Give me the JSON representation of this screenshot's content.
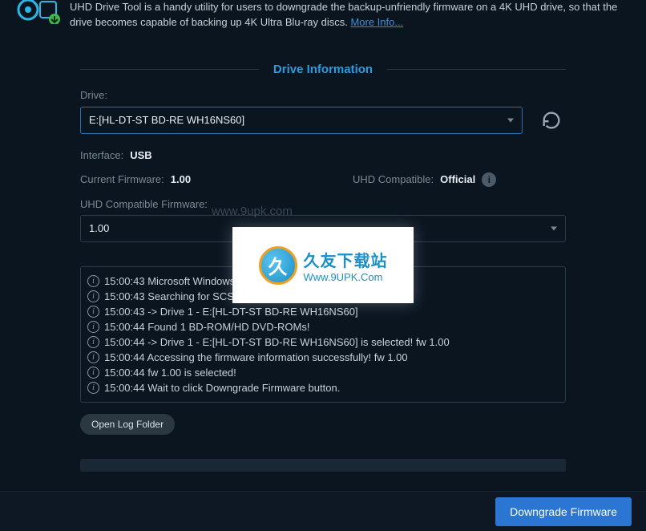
{
  "header": {
    "description": "UHD Drive Tool is a handy utility for users to downgrade the backup-unfriendly firmware on a 4K UHD drive, so that the drive becomes capable of backing up 4K Ultra Blu-ray discs. ",
    "more_info": "More Info..."
  },
  "section_title": "Drive Information",
  "drive": {
    "label": "Drive:",
    "value": "E:[HL-DT-ST BD-RE  WH16NS60]"
  },
  "interface": {
    "label": "Interface:",
    "value": "USB"
  },
  "current_fw": {
    "label": "Current Firmware:",
    "value": "1.00"
  },
  "uhd_compat": {
    "label": "UHD Compatible:",
    "value": "Official"
  },
  "compat_fw": {
    "label": "UHD Compatible Firmware:",
    "value": "1.00"
  },
  "log": [
    "15:00:43 Microsoft Windows 10 Professional Edition (build 18362)",
    "15:00:43 Searching for SCSI / ATAPI devices...",
    "15:00:43 -> Drive 1 - E:[HL-DT-ST BD-RE WH16NS60]",
    "15:00:44 Found 1 BD-ROM/HD DVD-ROMs!",
    "15:00:44 -> Drive 1 - E:[HL-DT-ST BD-RE WH16NS60] is selected! fw 1.00",
    "15:00:44 Accessing the firmware information successfully! fw 1.00",
    "15:00:44 fw 1.00 is selected!",
    "15:00:44 Wait to click Downgrade Firmware button."
  ],
  "open_log_label": "Open Log Folder",
  "downgrade_label": "Downgrade Firmware",
  "watermark": {
    "ghost": "www.9upk.com",
    "cn": "久友下载站",
    "url": "Www.9UPK.Com"
  }
}
